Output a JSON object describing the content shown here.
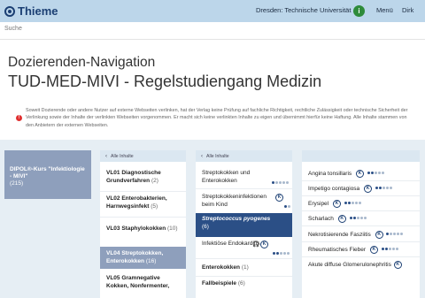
{
  "topbar": {
    "logo_text": "Thieme",
    "institution": "Dresden: Technische Universität",
    "info_icon": "i",
    "menu_label": "Menü",
    "user_label": "Dirk"
  },
  "search": {
    "placeholder": "Suche"
  },
  "page": {
    "title_line1": "Dozierenden-Navigation",
    "title_line2": "TUD-MED-MIVI - Regelstudiengang Medizin",
    "warning_icon": "!",
    "disclaimer": "Soweit Dozierende oder andere Nutzer auf externe Webseiten verlinken, hat der Verlag keine Prüfung auf fachliche Richtigkeit, rechtliche Zulässigkeit oder technische Sicherheit der Verlinkung sowie der Inhalte der verlinkten Webseiten vorgenommen. Er macht sich keine verlinkten Inhalte zu eigen und übernimmt hierfür keine Haftung. Alle Inhalte stammen von den Anbietern der externen Webseiten."
  },
  "col1": {
    "title": "DIPOL®-Kurs \"Infektiologie - MIVI\"",
    "count": "(215)"
  },
  "col2": {
    "header": "Alle Inhalte",
    "items": [
      {
        "label": "VL01 Diagnostische Grundverfahren",
        "count": "(2)"
      },
      {
        "label": "VL02 Enterobakterien, Harnwegsinfekt",
        "count": "(5)"
      },
      {
        "label": "VL03 Staphylokokken",
        "count": "(10)"
      },
      {
        "label": "VL04 Streptokokken, Enterokokken",
        "count": "(16)"
      },
      {
        "label": "VL05 Gramnegative Kokken, Nonfermenter,",
        "count": ""
      }
    ]
  },
  "col3": {
    "header": "Alle Inhalte",
    "items": [
      {
        "label": "Streptokokken und Enterokokken",
        "count": "",
        "badge": "K"
      },
      {
        "label": "Streptokokkeninfektionen beim Kind",
        "count": "",
        "badge": "K"
      },
      {
        "label": "Streptococcus pyogenes",
        "count": "(6)"
      },
      {
        "label": "Infektiöse Endokarditis",
        "count": "",
        "badge": "K",
        "audio": "🎧"
      },
      {
        "label": "Enterokokken",
        "count": "(1)"
      },
      {
        "label": "Fallbeispiele",
        "count": "(6)"
      }
    ]
  },
  "col4": {
    "items": [
      {
        "label": "Angina tonsillaris",
        "badge": "K"
      },
      {
        "label": "Impetigo contagiosa",
        "badge": "K"
      },
      {
        "label": "Erysipel",
        "badge": "K"
      },
      {
        "label": "Scharlach",
        "badge": "K"
      },
      {
        "label": "Nekrotisierende Fasziitis",
        "badge": "K"
      },
      {
        "label": "Rheumatisches Fieber",
        "badge": "K"
      },
      {
        "label": "Akute diffuse Glomerulonephritis",
        "badge": "K"
      }
    ]
  }
}
